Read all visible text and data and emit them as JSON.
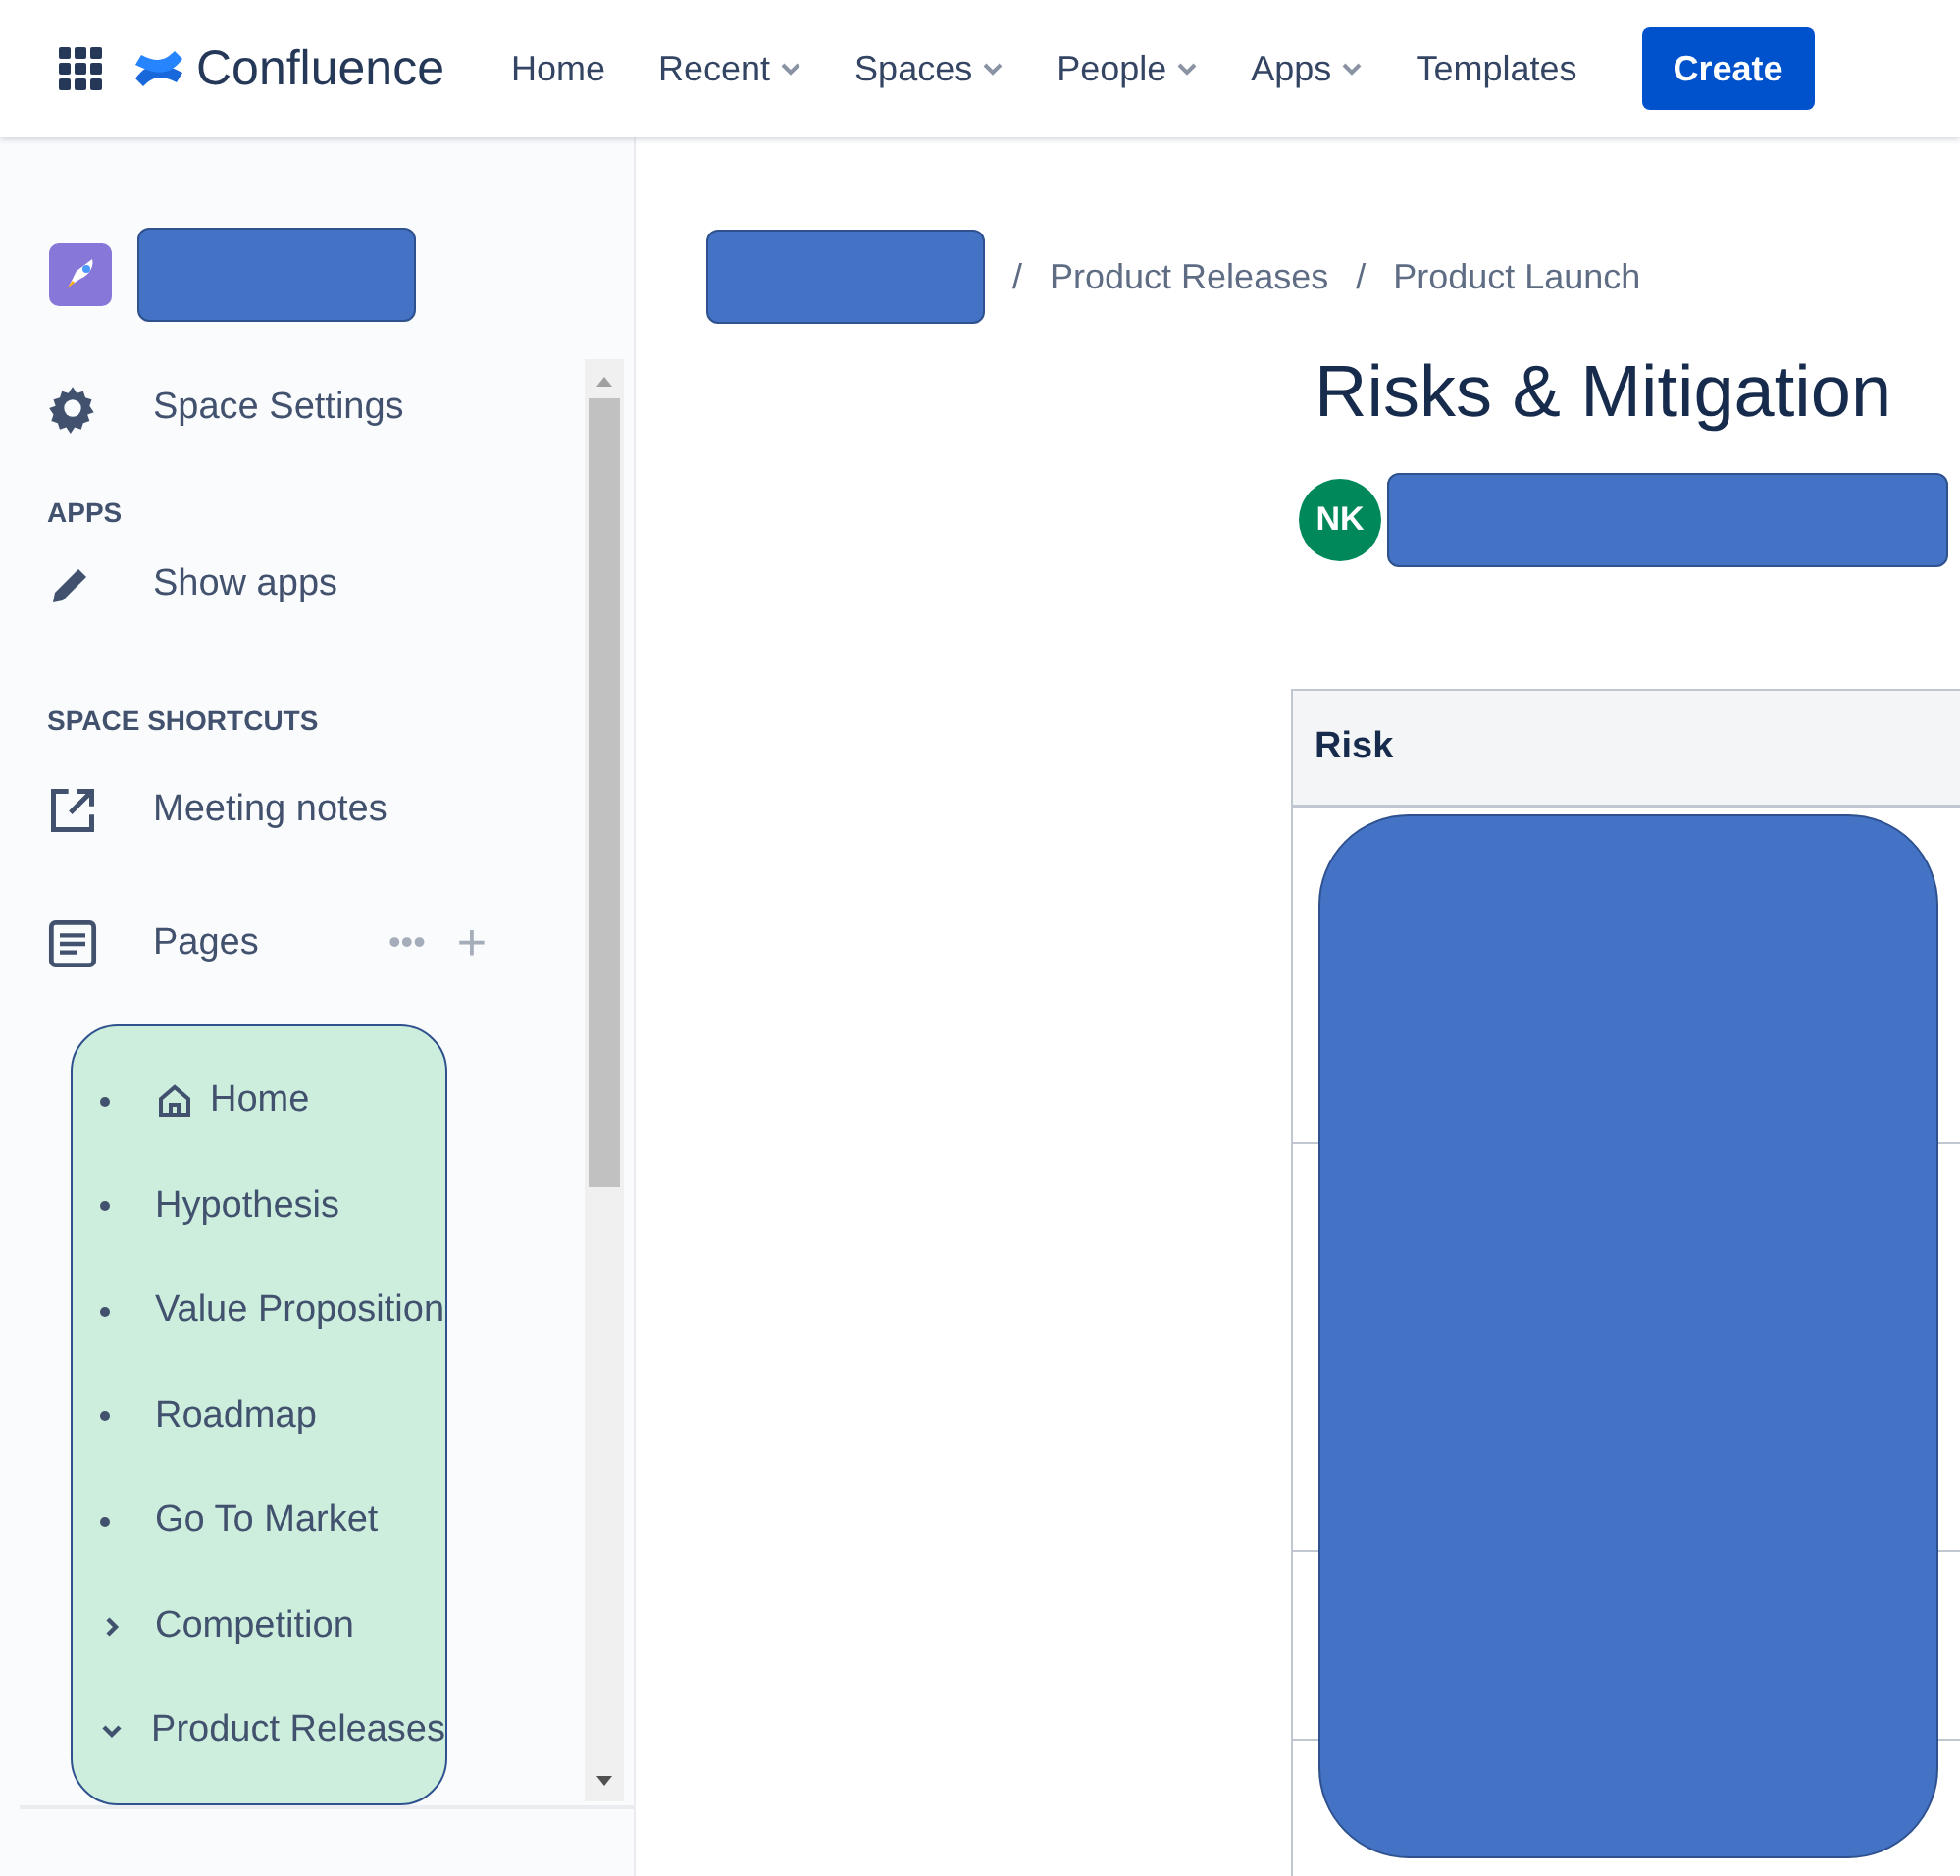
{
  "topnav": {
    "brand": "Confluence",
    "items": [
      {
        "label": "Home",
        "dropdown": false
      },
      {
        "label": "Recent",
        "dropdown": true
      },
      {
        "label": "Spaces",
        "dropdown": true
      },
      {
        "label": "People",
        "dropdown": true
      },
      {
        "label": "Apps",
        "dropdown": true
      },
      {
        "label": "Templates",
        "dropdown": false
      }
    ],
    "create": "Create"
  },
  "sidebar": {
    "settings": "Space Settings",
    "apps_heading": "APPS",
    "show_apps": "Show apps",
    "shortcuts_heading": "SPACE SHORTCUTS",
    "shortcuts": [
      "Meeting notes"
    ],
    "pages_label": "Pages",
    "more": "•••",
    "add": "+",
    "pages": [
      {
        "label": "Home",
        "kind": "home"
      },
      {
        "label": "Hypothesis",
        "kind": "bullet"
      },
      {
        "label": "Value Proposition",
        "kind": "bullet"
      },
      {
        "label": "Roadmap",
        "kind": "bullet"
      },
      {
        "label": "Go To Market",
        "kind": "bullet"
      },
      {
        "label": "Competition",
        "kind": "collapsed"
      },
      {
        "label": "Product Releases",
        "kind": "expanded"
      }
    ]
  },
  "breadcrumbs": [
    {
      "separator": "/",
      "label": "Product Releases"
    },
    {
      "separator": "/",
      "label": "Product Launch"
    }
  ],
  "page": {
    "title": "Risks & Mitigation",
    "author_initials": "NK",
    "table": {
      "columns": [
        "Risk"
      ]
    }
  }
}
